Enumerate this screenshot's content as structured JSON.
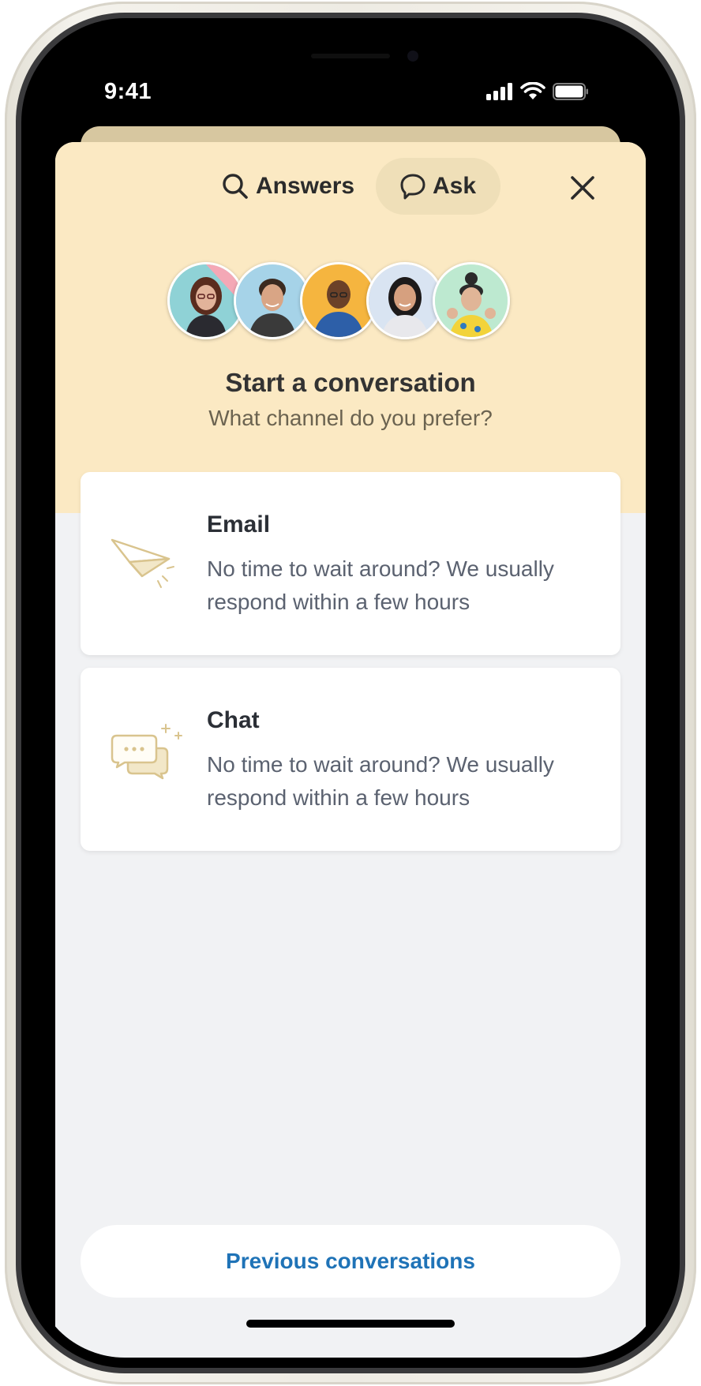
{
  "status_bar": {
    "time": "9:41"
  },
  "header": {
    "tabs": [
      {
        "label": "Answers",
        "icon": "search-icon",
        "active": false
      },
      {
        "label": "Ask",
        "icon": "speech-bubble-icon",
        "active": true
      }
    ],
    "close_icon": "close-icon"
  },
  "intro": {
    "title": "Start a conversation",
    "subtitle": "What channel do you prefer?"
  },
  "channels": [
    {
      "title": "Email",
      "description": "No time to wait around? We usually respond within a few hours",
      "icon": "paper-plane-icon"
    },
    {
      "title": "Chat",
      "description": "No time to wait around? We usually respond within a few hours",
      "icon": "chat-bubbles-icon"
    }
  ],
  "footer": {
    "previous_conversations_label": "Previous conversations"
  },
  "colors": {
    "header_background": "#fbe9c3",
    "active_tab_background": "#efdfb8",
    "sheet_background": "#f1f2f4",
    "link_blue": "#1f73b7",
    "icon_gold": "#d9c48e"
  }
}
